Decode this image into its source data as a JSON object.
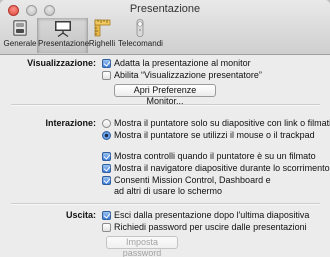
{
  "window": {
    "title": "Presentazione"
  },
  "toolbar": {
    "items": [
      {
        "label": "Generale",
        "icon": "switch-icon"
      },
      {
        "label": "Presentazione",
        "icon": "presentation-screen-icon",
        "selected": true
      },
      {
        "label": "Righelli",
        "icon": "ruler-icon"
      },
      {
        "label": "Telecomandi",
        "icon": "remote-icon"
      }
    ]
  },
  "visualizzazione": {
    "label": "Visualizzazione:",
    "adapt": {
      "label": "Adatta la presentazione al monitor",
      "checked": true
    },
    "presenter": {
      "label": "Abilita “Visualizzazione presentatore”",
      "checked": false
    },
    "button": "Apri Preferenze Monitor..."
  },
  "interazione": {
    "label": "Interazione:",
    "radio_links": {
      "label": "Mostra il puntatore solo su diapositive con link o filmati",
      "selected": false
    },
    "radio_mouse": {
      "label": "Mostra il puntatore se utilizzi il mouse o il trackpad",
      "selected": true
    },
    "controls": {
      "label": "Mostra controlli quando il puntatore è su un filmato",
      "checked": true
    },
    "navigator": {
      "label": "Mostra il navigatore diapositive durante lo scorrimento",
      "checked": true
    },
    "mission": {
      "label_line1": "Consenti Mission Control, Dashboard e",
      "label_line2": "ad altri di usare lo schermo",
      "checked": true
    }
  },
  "uscita": {
    "label": "Uscita:",
    "exit": {
      "label": "Esci dalla presentazione dopo l'ultima diapositiva",
      "checked": true
    },
    "password": {
      "label": "Richiedi password per uscire dalle presentazioni",
      "checked": false
    },
    "button": "Imposta password"
  }
}
